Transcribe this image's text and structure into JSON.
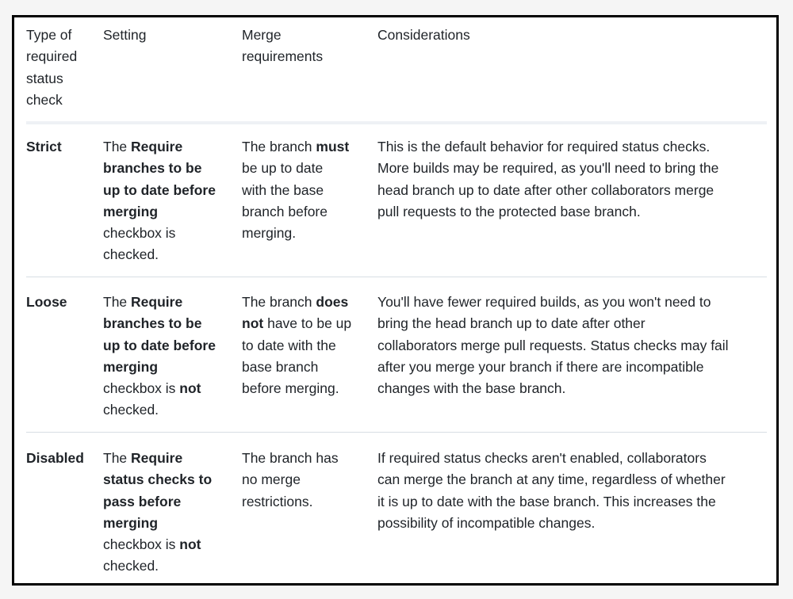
{
  "table": {
    "headers": [
      [
        "Type of",
        "required",
        "status",
        "check"
      ],
      [
        "Setting"
      ],
      [
        "Merge",
        "requirements"
      ],
      [
        "Considerations"
      ]
    ],
    "rows": [
      {
        "type": "Strict",
        "setting": [
          [
            {
              "t": "The "
            },
            {
              "t": "Require",
              "b": true
            }
          ],
          [
            {
              "t": "branches to be",
              "b": true
            }
          ],
          [
            {
              "t": "up to date before",
              "b": true
            }
          ],
          [
            {
              "t": "merging",
              "b": true
            }
          ],
          [
            {
              "t": "checkbox is"
            }
          ],
          [
            {
              "t": "checked."
            }
          ]
        ],
        "merge": [
          [
            {
              "t": "The branch "
            },
            {
              "t": "must",
              "b": true
            }
          ],
          [
            {
              "t": "be up to date"
            }
          ],
          [
            {
              "t": "with the base"
            }
          ],
          [
            {
              "t": "branch before"
            }
          ],
          [
            {
              "t": "merging."
            }
          ]
        ],
        "considerations": [
          "This is the default behavior for required status checks.",
          "More builds may be required, as you'll need to bring the",
          "head branch up to date after other collaborators merge",
          "pull requests to the protected base branch."
        ]
      },
      {
        "type": "Loose",
        "setting": [
          [
            {
              "t": "The "
            },
            {
              "t": "Require",
              "b": true
            }
          ],
          [
            {
              "t": "branches to be",
              "b": true
            }
          ],
          [
            {
              "t": "up to date before",
              "b": true
            }
          ],
          [
            {
              "t": "merging",
              "b": true
            }
          ],
          [
            {
              "t": "checkbox is "
            },
            {
              "t": "not",
              "b": true
            }
          ],
          [
            {
              "t": "checked."
            }
          ]
        ],
        "merge": [
          [
            {
              "t": "The branch "
            },
            {
              "t": "does",
              "b": true
            }
          ],
          [
            {
              "t": "not",
              "b": true
            },
            {
              "t": " have to be up"
            }
          ],
          [
            {
              "t": "to date with the"
            }
          ],
          [
            {
              "t": "base branch"
            }
          ],
          [
            {
              "t": "before merging."
            }
          ]
        ],
        "considerations": [
          "You'll have fewer required builds, as you won't need to",
          "bring the head branch up to date after other",
          "collaborators merge pull requests. Status checks may fail",
          "after you merge your branch if there are incompatible",
          "changes with the base branch."
        ]
      },
      {
        "type": "Disabled",
        "setting": [
          [
            {
              "t": "The "
            },
            {
              "t": "Require",
              "b": true
            }
          ],
          [
            {
              "t": "status checks to",
              "b": true
            }
          ],
          [
            {
              "t": "pass before",
              "b": true
            }
          ],
          [
            {
              "t": "merging",
              "b": true
            }
          ],
          [
            {
              "t": "checkbox is "
            },
            {
              "t": "not",
              "b": true
            }
          ],
          [
            {
              "t": "checked."
            }
          ]
        ],
        "merge": [
          [
            {
              "t": "The branch has"
            }
          ],
          [
            {
              "t": "no merge"
            }
          ],
          [
            {
              "t": "restrictions."
            }
          ]
        ],
        "considerations": [
          "If required status checks aren't enabled, collaborators",
          "can merge the branch at any time, regardless of whether",
          "it is up to date with the base branch. This increases the",
          "possibility of incompatible changes."
        ]
      }
    ]
  }
}
